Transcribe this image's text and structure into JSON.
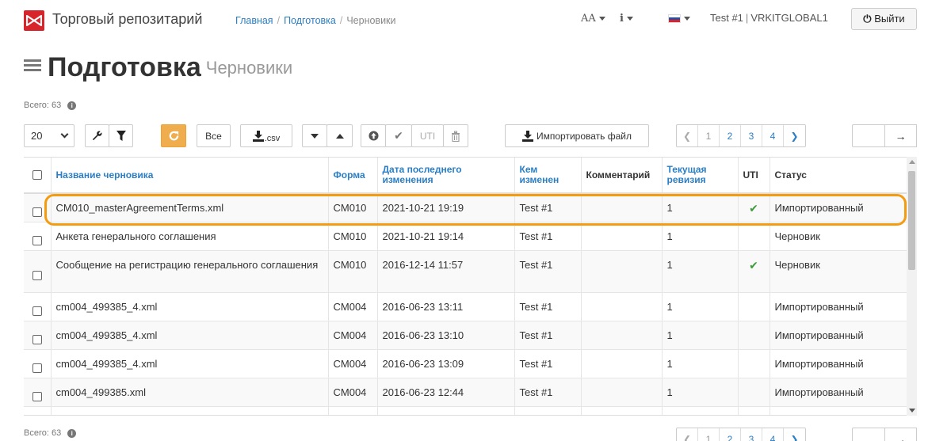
{
  "nav": {
    "app_title": "Торговый репозитарий",
    "breadcrumb": [
      "Главная",
      "Подготовка",
      "Черновики"
    ],
    "font_size_label": "AA",
    "info_label": "i",
    "user": "Test #1",
    "org": "VRKITGLOBAL1",
    "logout": "Выйти"
  },
  "header": {
    "title": "Подготовка",
    "subtitle": "Черновики"
  },
  "total_label": "Всего: 63",
  "toolbar": {
    "page_size": "20",
    "all_label": "Все",
    "csv_label": ".csv",
    "uti_label": "UTI",
    "import_label": "Импортировать файл"
  },
  "pagination": {
    "pages": [
      "1",
      "2",
      "3",
      "4"
    ],
    "current": "1",
    "go": "→"
  },
  "table": {
    "headers": {
      "name": "Название черновика",
      "form": "Форма",
      "date": "Дата последнего изменения",
      "author": "Кем изменен",
      "comment": "Комментарий",
      "revision": "Текущая ревизия",
      "uti": "UTI",
      "status": "Статус"
    },
    "rows": [
      {
        "name": "CM010_masterAgreementTerms.xml",
        "form": "CM010",
        "date": "2021-10-21 19:19",
        "author": "Test #1",
        "comment": "",
        "revision": "1",
        "uti": "✔",
        "status": "Импортированный"
      },
      {
        "name": "Анкета генерального соглашения",
        "form": "CM010",
        "date": "2021-10-21 19:14",
        "author": "Test #1",
        "comment": "",
        "revision": "1",
        "uti": "",
        "status": "Черновик"
      },
      {
        "name": "Сообщение на регистрацию генерального соглашения",
        "form": "CM010",
        "date": "2016-12-14 11:57",
        "author": "Test #1",
        "comment": "",
        "revision": "1",
        "uti": "✔",
        "status": "Черновик"
      },
      {
        "name": "cm004_499385_4.xml",
        "form": "CM004",
        "date": "2016-06-23 13:11",
        "author": "Test #1",
        "comment": "",
        "revision": "1",
        "uti": "",
        "status": "Импортированный"
      },
      {
        "name": "cm004_499385_4.xml",
        "form": "CM004",
        "date": "2016-06-23 13:10",
        "author": "Test #1",
        "comment": "",
        "revision": "1",
        "uti": "",
        "status": "Импортированный"
      },
      {
        "name": "cm004_499385_4.xml",
        "form": "CM004",
        "date": "2016-06-23 13:09",
        "author": "Test #1",
        "comment": "",
        "revision": "1",
        "uti": "",
        "status": "Импортированный"
      },
      {
        "name": "cm004_499385.xml",
        "form": "CM004",
        "date": "2016-06-23 12:44",
        "author": "Test #1",
        "comment": "",
        "revision": "1",
        "uti": "",
        "status": "Импортированный"
      }
    ]
  },
  "colors": {
    "brand": "#d8252c",
    "link": "#2a7ec5",
    "refresh": "#f0ad4e",
    "highlight": "#f39c12",
    "check": "#3c9b3c"
  }
}
